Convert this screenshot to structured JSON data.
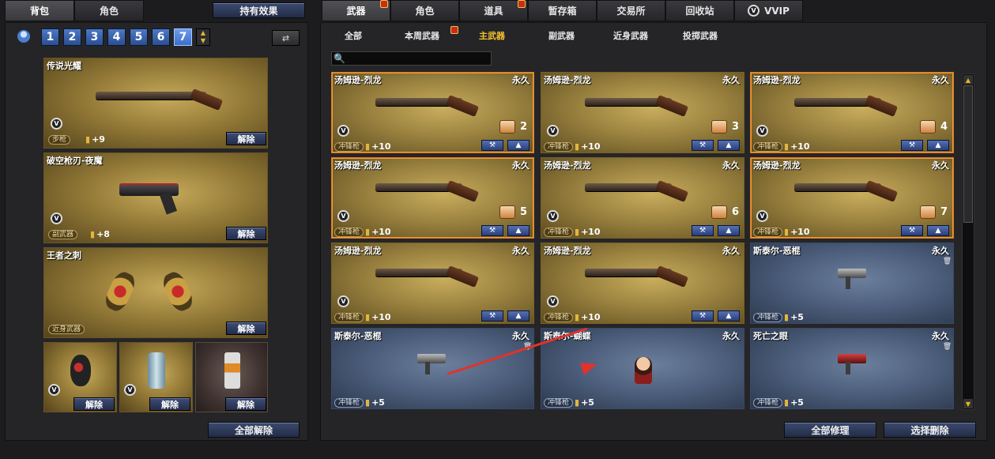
{
  "left_tabs": [
    "背包",
    "角色"
  ],
  "hold_effect_label": "持有效果",
  "page_numbers": [
    "1",
    "2",
    "3",
    "4",
    "5",
    "6",
    "7"
  ],
  "active_page": "7",
  "equip": [
    {
      "name": "传说光耀",
      "category": "步枪",
      "ammo": "+9",
      "release": "解除"
    },
    {
      "name": "破空枪刃-夜魔",
      "category": "副武器",
      "ammo": "+8",
      "release": "解除"
    },
    {
      "name": "王者之刺",
      "category": "近身武器",
      "release": "解除"
    }
  ],
  "throwables_release": "解除",
  "release_all_label": "全部解除",
  "main_tabs": [
    "武器",
    "角色",
    "道具",
    "暂存箱",
    "交易所",
    "回收站",
    "VVIP"
  ],
  "sub_tabs": [
    "全部",
    "本周武器",
    "主武器",
    "副武器",
    "近身武器",
    "投掷武器"
  ],
  "active_sub_tab": "主武器",
  "search": {
    "placeholder": ""
  },
  "cards": [
    {
      "name": "汤姆逊-烈龙",
      "duration": "永久",
      "category": "冲锋枪",
      "ammo": "+10",
      "count": "2"
    },
    {
      "name": "汤姆逊-烈龙",
      "duration": "永久",
      "category": "冲锋枪",
      "ammo": "+10",
      "count": "3"
    },
    {
      "name": "汤姆逊-烈龙",
      "duration": "永久",
      "category": "冲锋枪",
      "ammo": "+10",
      "count": "4"
    },
    {
      "name": "汤姆逊-烈龙",
      "duration": "永久",
      "category": "冲锋枪",
      "ammo": "+10",
      "count": "5"
    },
    {
      "name": "汤姆逊-烈龙",
      "duration": "永久",
      "category": "冲锋枪",
      "ammo": "+10",
      "count": "6"
    },
    {
      "name": "汤姆逊-烈龙",
      "duration": "永久",
      "category": "冲锋枪",
      "ammo": "+10",
      "count": "7"
    },
    {
      "name": "汤姆逊-烈龙",
      "duration": "永久",
      "category": "冲锋枪",
      "ammo": "+10"
    },
    {
      "name": "汤姆逊-烈龙",
      "duration": "永久",
      "category": "冲锋枪",
      "ammo": "+10"
    },
    {
      "name": "斯泰尔-恶棍",
      "duration": "永久",
      "category": "冲锋枪",
      "ammo": "+5"
    },
    {
      "name": "斯泰尔-恶棍",
      "duration": "永久",
      "category": "冲锋枪",
      "ammo": "+5"
    },
    {
      "name": "斯泰尔-蝴蝶",
      "duration": "永久",
      "category": "冲锋枪",
      "ammo": "+5"
    },
    {
      "name": "死亡之眼",
      "duration": "永久",
      "category": "冲锋枪",
      "ammo": "+5"
    }
  ],
  "repair_all_label": "全部修理",
  "select_delete_label": "选择删除",
  "colors": {
    "gold_card": "#9b8340",
    "blue_card": "#4a5c79",
    "accent": "#f5c12c",
    "arrow": "#e2322a"
  }
}
